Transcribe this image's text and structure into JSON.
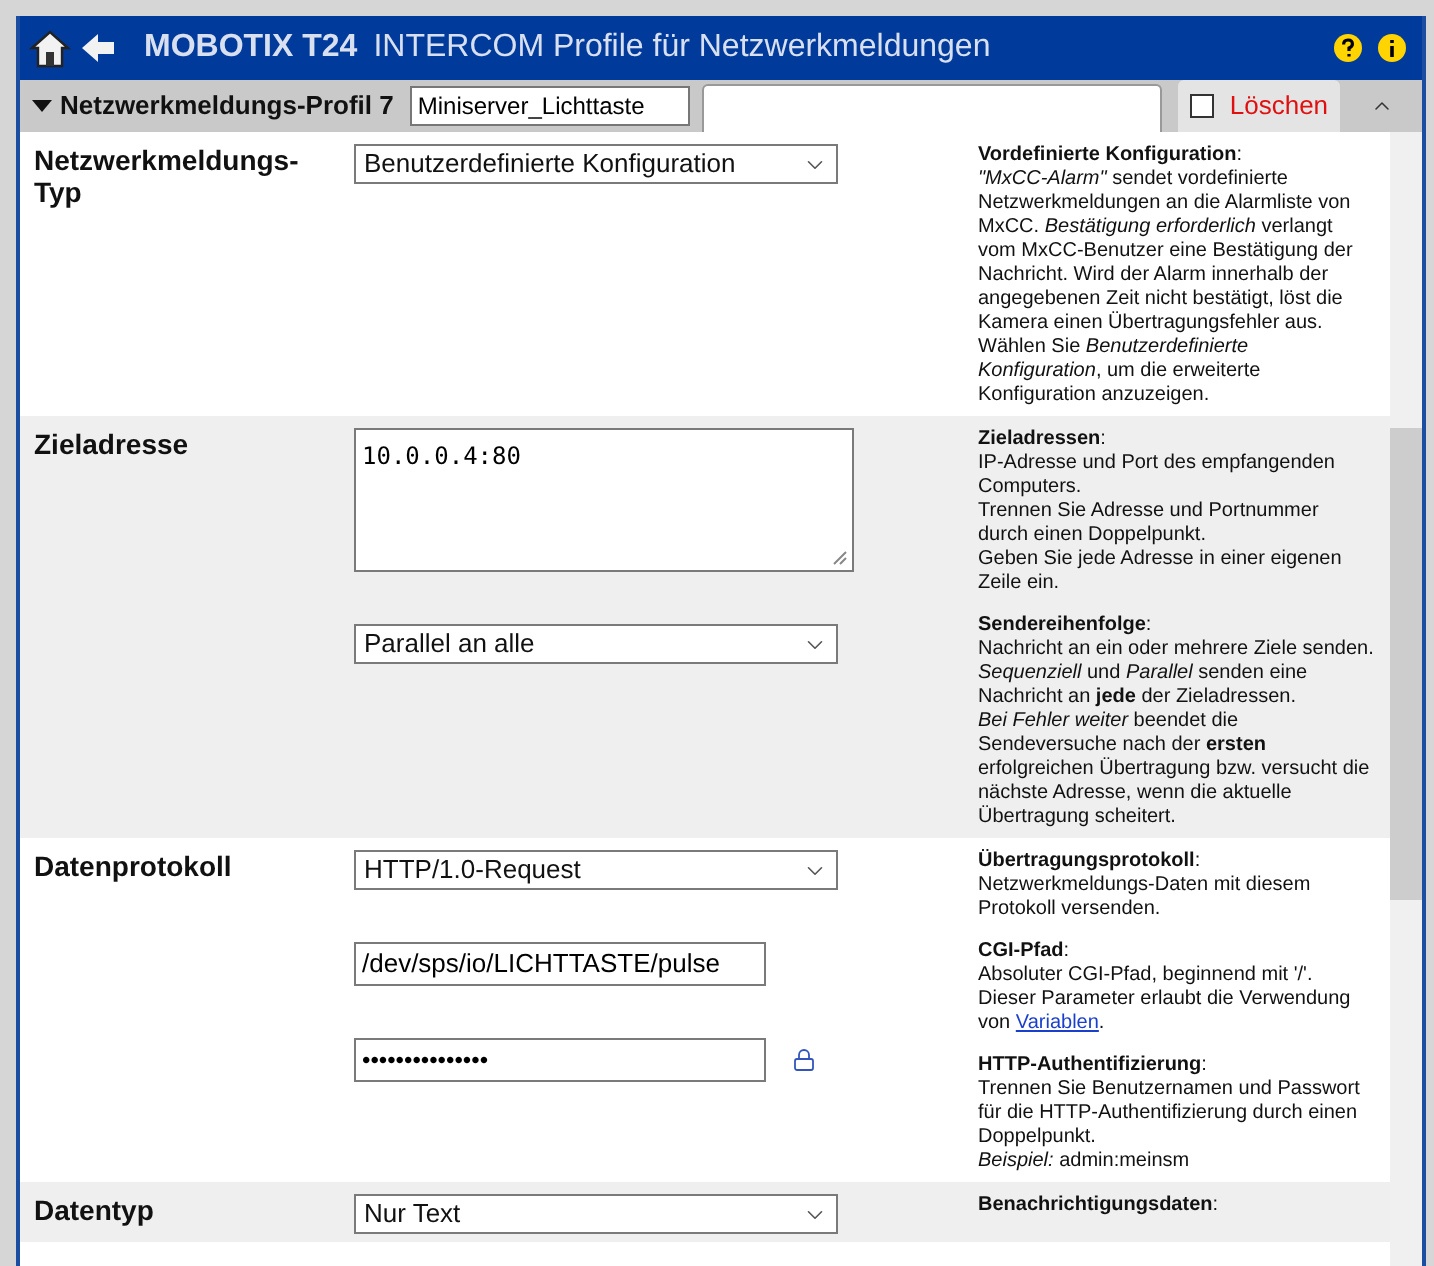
{
  "header": {
    "brand": "MOBOTIX T24",
    "title": "INTERCOM Profile für Netzwerkmeldungen"
  },
  "profile_bar": {
    "label": "Netzwerkmeldungs-Profil 7",
    "name_value": "Miniserver_Lichttaste",
    "delete_checked": false,
    "delete_label": "Löschen",
    "expanded": true
  },
  "rows": [
    {
      "label": "Netzwerkmeldungs-Typ",
      "shaded": false,
      "controls": [
        {
          "kind": "dropdown",
          "value": "Benutzerdefinierte Konfiguration"
        }
      ],
      "help": [
        {
          "text": "**Vordefinierte Konfiguration**:\n*\"MxCC-Alarm\"* sendet vordefinierte Netzwerkmeldungen an die Alarmliste von MxCC. *Bestätigung erforderlich* verlangt vom MxCC-Benutzer eine Bestätigung der Nachricht. Wird der Alarm innerhalb der angegebenen Zeit nicht bestätigt, löst die Kamera einen Übertragungsfehler aus.\nWählen Sie *Benutzerdefinierte Konfiguration*, um die erweiterte Konfiguration anzuzeigen."
        }
      ]
    },
    {
      "label": "Zieladresse",
      "shaded": true,
      "controls": [
        {
          "kind": "textarea",
          "value": "10.0.0.4:80"
        },
        {
          "kind": "dropdown",
          "value": "Parallel an alle"
        }
      ],
      "help": [
        {
          "text": "**Zieladressen**:\nIP-Adresse und Port des empfangenden Computers.\nTrennen Sie Adresse und Portnummer durch einen Doppelpunkt.\nGeben Sie jede Adresse in einer eigenen Zeile ein."
        },
        {
          "text": "**Sendereihenfolge**:\nNachricht an ein oder mehrere Ziele senden.\n*Sequenziell* und *Parallel* senden eine Nachricht an **jede** der Zieladressen.\n*Bei Fehler weiter* beendet die Sendeversuche nach der **ersten** erfolgreichen Übertragung bzw. versucht die nächste Adresse, wenn die aktuelle Übertragung scheitert."
        }
      ]
    },
    {
      "label": "Datenprotokoll",
      "shaded": false,
      "controls": [
        {
          "kind": "dropdown",
          "value": "HTTP/1.0-Request"
        },
        {
          "kind": "text",
          "value": "/dev/sps/io/LICHTTASTE/pulse"
        },
        {
          "kind": "password",
          "value": "•••••••••••••••"
        }
      ],
      "help": [
        {
          "text": "**Übertragungsprotokoll**:\nNetzwerkmeldungs-Daten mit diesem Protokoll versenden."
        },
        {
          "text": "**CGI-Pfad**:\nAbsoluter CGI-Pfad, beginnend mit '/'.\nDieser Parameter erlaubt die Verwendung von ",
          "link": "Variablen",
          "after": "."
        },
        {
          "text": "**HTTP-Authentifizierung**:\nTrennen Sie Benutzernamen und Passwort für die HTTP-Authentifizierung durch einen Doppelpunkt.\n*Beispiel:* admin:meinsm"
        }
      ]
    },
    {
      "label": "Datentyp",
      "shaded": true,
      "controls": [
        {
          "kind": "dropdown",
          "value": "Nur Text"
        }
      ],
      "help": [
        {
          "text": "**Benachrichtigungsdaten**:"
        }
      ]
    }
  ]
}
